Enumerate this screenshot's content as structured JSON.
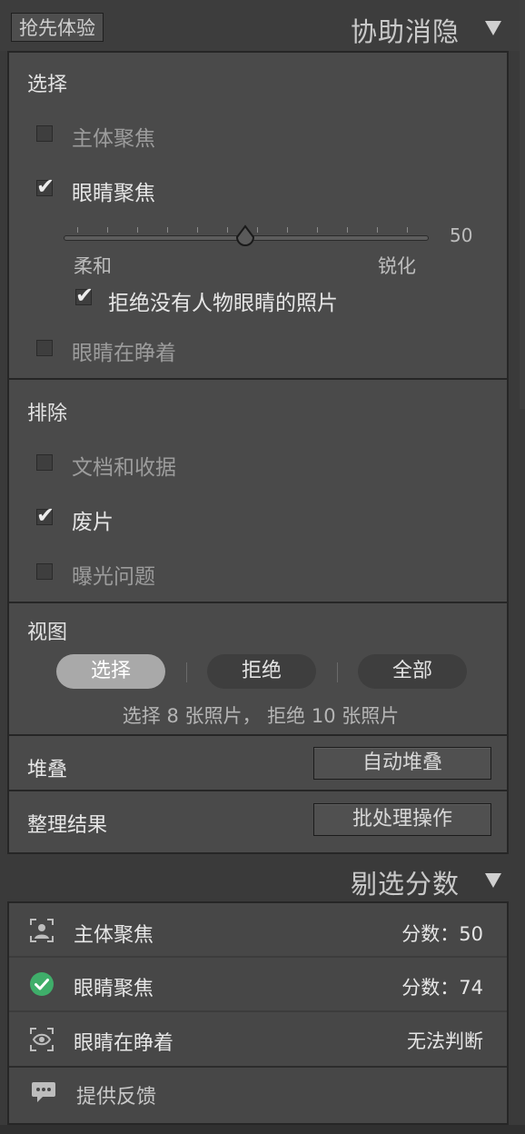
{
  "header": {
    "beta_label": "抢先体验",
    "title": "协助消隐"
  },
  "select_section": {
    "title": "选择",
    "subject_focus": {
      "label": "主体聚焦",
      "checked": false
    },
    "eye_focus": {
      "label": "眼睛聚焦",
      "checked": true
    },
    "slider": {
      "value": "50",
      "level": 50,
      "min_label": "柔和",
      "max_label": "锐化"
    },
    "reject_no_eyes": {
      "label": "拒绝没有人物眼睛的照片",
      "checked": true
    },
    "eyes_open": {
      "label": "眼睛在睁着",
      "checked": false
    }
  },
  "exclude_section": {
    "title": "排除",
    "documents": {
      "label": "文档和收据",
      "checked": false
    },
    "rejects": {
      "label": "废片",
      "checked": true
    },
    "exposure": {
      "label": "曝光问题",
      "checked": false
    }
  },
  "view_section": {
    "title": "视图",
    "tabs": [
      "选择",
      "拒绝",
      "全部"
    ],
    "active_tab": 0,
    "summary": "选择 8 张照片， 拒绝 10 张照片"
  },
  "stack_row": {
    "label": "堆叠",
    "button": "自动堆叠"
  },
  "organize_row": {
    "label": "整理结果",
    "button": "批处理操作"
  },
  "scores_panel": {
    "title": "剔选分数",
    "rows": [
      {
        "name": "主体聚焦",
        "value": "分数：50",
        "icon": "subject-icon"
      },
      {
        "name": "眼睛聚焦",
        "value": "分数：74",
        "icon": "check-circle-icon"
      },
      {
        "name": "眼睛在睁着",
        "value": "无法判断",
        "icon": "eye-icon"
      }
    ],
    "feedback": "提供反馈"
  },
  "colors": {
    "panel_bg": "#4a4a4a",
    "active_pill": "#a9a9a9",
    "success_green": "#3fae6a"
  }
}
